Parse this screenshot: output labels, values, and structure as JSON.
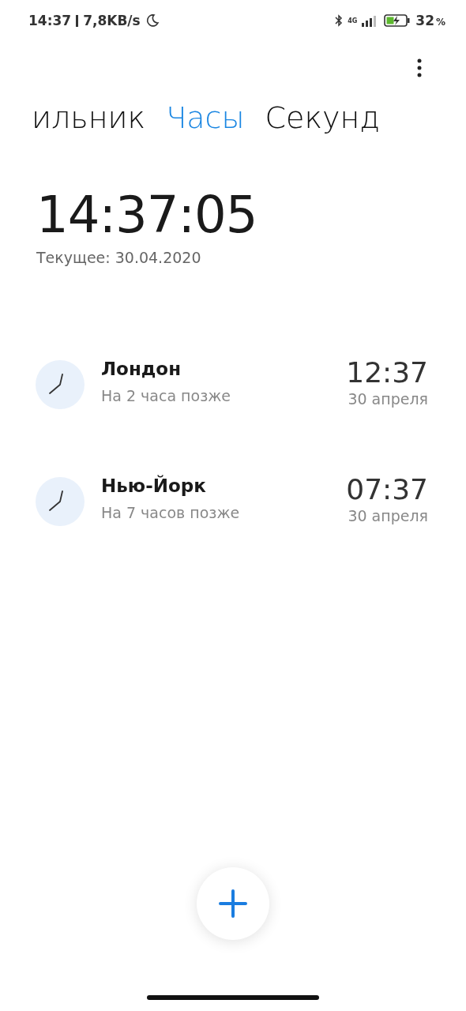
{
  "status_bar": {
    "time": "14:37",
    "speed": "7,8KB/s",
    "network": "4G",
    "battery": "32",
    "battery_unit": "%"
  },
  "tabs": [
    {
      "label": "ильник",
      "selected": false
    },
    {
      "label": "Часы",
      "selected": true
    },
    {
      "label": "Секунд",
      "selected": false
    }
  ],
  "clock": {
    "time": "14:37:05",
    "date": "Текущее: 30.04.2020"
  },
  "cities": [
    {
      "name": "Лондон",
      "offset": "На 2 часа позже",
      "time": "12:37",
      "date": "30 апреля"
    },
    {
      "name": "Нью-Йорк",
      "offset": "На 7 часов позже",
      "time": "07:37",
      "date": "30 апреля"
    }
  ]
}
